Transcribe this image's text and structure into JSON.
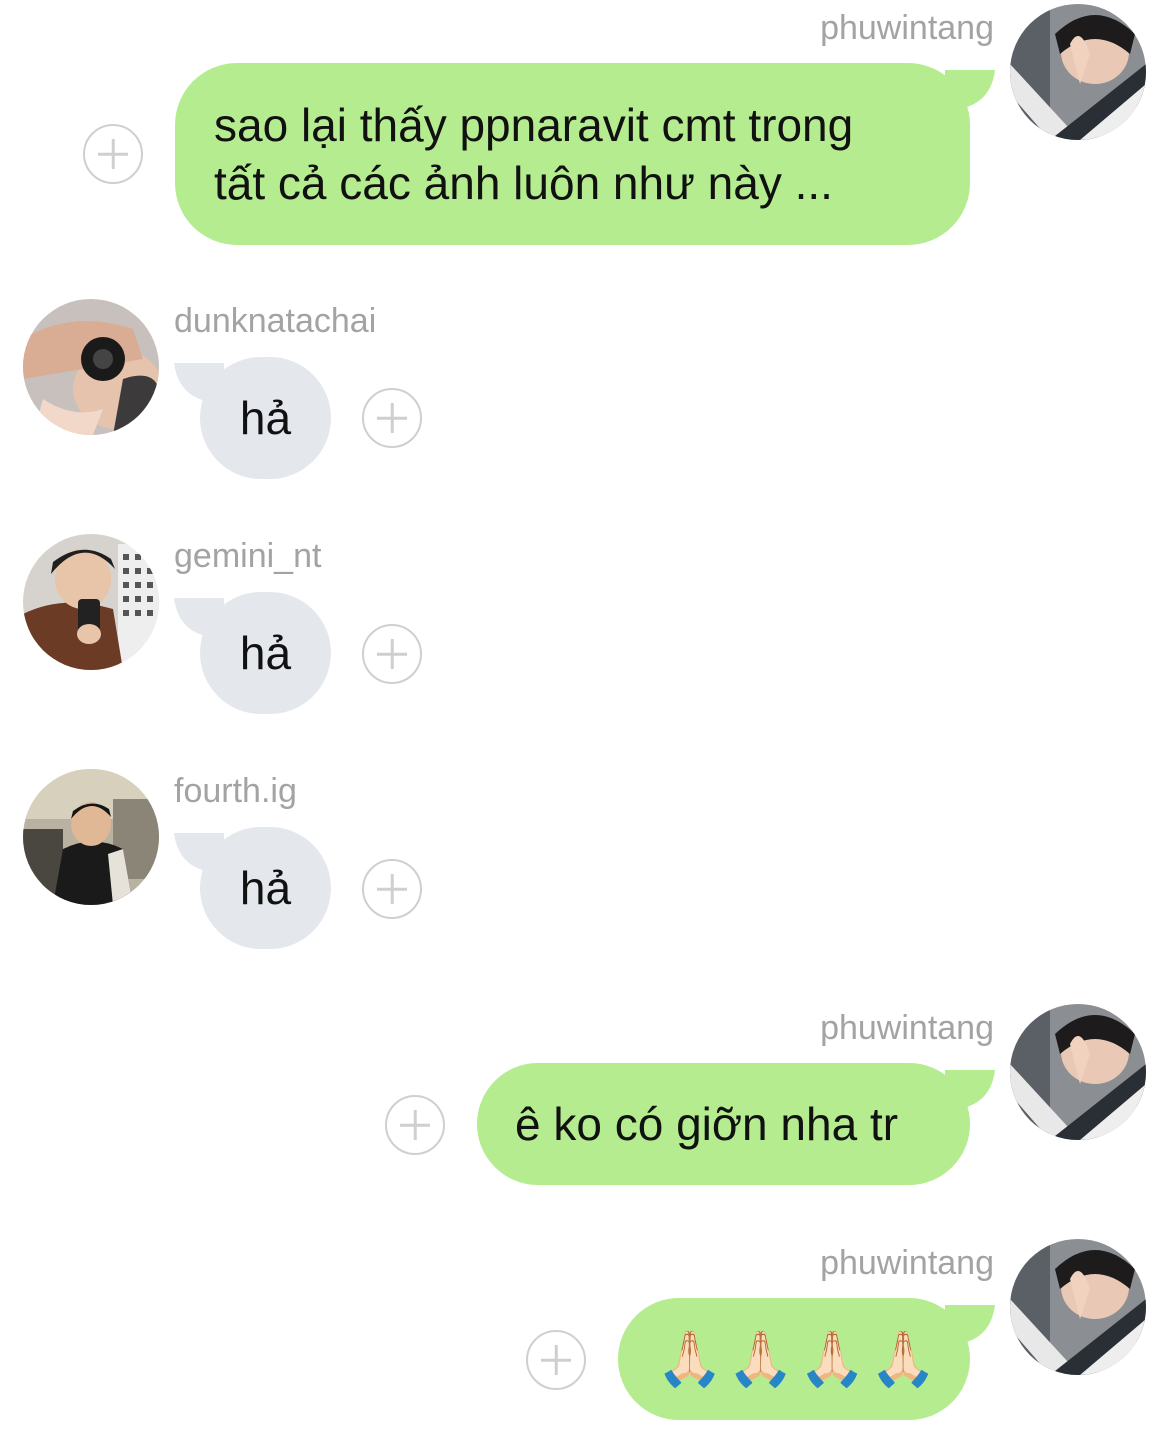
{
  "messages": [
    {
      "sender": "phuwintang",
      "text_lines": [
        "sao lại thấy ppnaravit cmt trong",
        "tất cả các ảnh luôn như này ..."
      ],
      "direction": "outgoing"
    },
    {
      "sender": "dunknatachai",
      "text": "hả",
      "direction": "incoming"
    },
    {
      "sender": "gemini_nt",
      "text": "hả",
      "direction": "incoming"
    },
    {
      "sender": "fourth.ig",
      "text": "hả",
      "direction": "incoming"
    },
    {
      "sender": "phuwintang",
      "text": "ê ko có giỡn nha tr",
      "direction": "outgoing"
    },
    {
      "sender": "phuwintang",
      "text": "🙏🏻🙏🏻🙏🏻🙏🏻",
      "direction": "outgoing"
    }
  ],
  "colors": {
    "outgoing_bubble": "#b4ec8f",
    "incoming_bubble": "#e4e8ed",
    "username": "#a3a3a3",
    "add_icon": "#cfcfcf"
  },
  "icons": {
    "add_reaction": "plus-circle-icon"
  }
}
